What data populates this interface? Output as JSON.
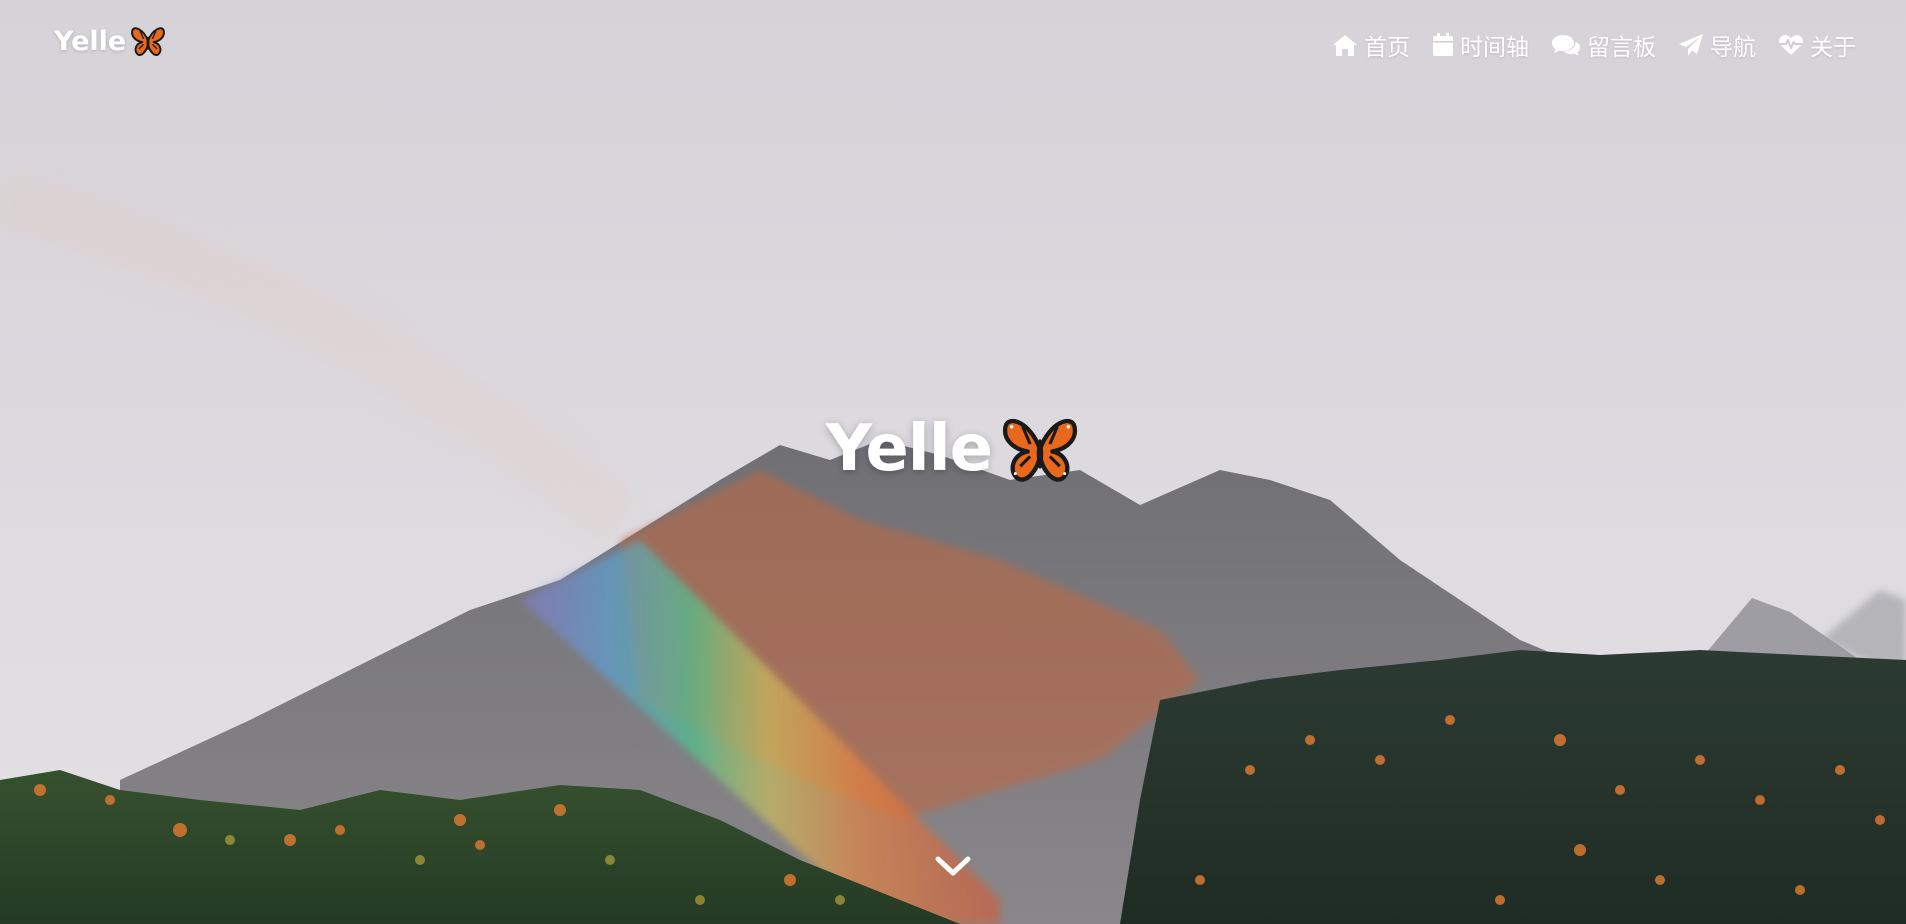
{
  "brand": {
    "name": "Yelle",
    "icon": "butterfly-icon"
  },
  "nav": {
    "items": [
      {
        "label": "首页",
        "icon": "home-icon"
      },
      {
        "label": "时间轴",
        "icon": "calendar-icon"
      },
      {
        "label": "留言板",
        "icon": "comments-icon"
      },
      {
        "label": "导航",
        "icon": "paper-plane-icon"
      },
      {
        "label": "关于",
        "icon": "heartbeat-icon"
      }
    ]
  },
  "hero": {
    "title": "Yelle",
    "icon": "butterfly-icon",
    "scroll_icon": "chevron-down-icon"
  },
  "colors": {
    "sky": "#d8d6db",
    "mountain": "#7d7c80",
    "forest": "#2a3a30",
    "butterfly": "#e8691e",
    "text": "#ffffff"
  }
}
